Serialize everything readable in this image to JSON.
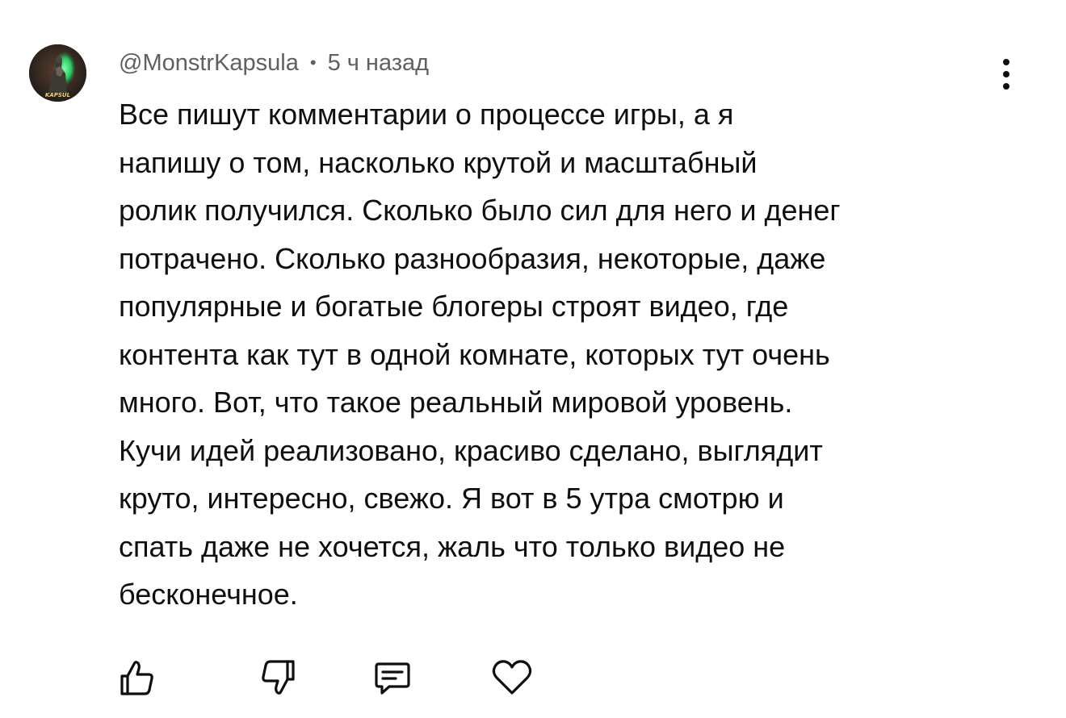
{
  "comment": {
    "author": "@MonstrKapsula",
    "separator": "•",
    "time_ago": "5 ч назад",
    "text": "Все пишут комментарии о процессе игры, а я\nнапишу о том, насколько крутой и масштабный\nролик получился. Сколько было сил для него и денег\nпотрачено. Сколько разнообразия, некоторые, даже\nпопулярные и богатые блогеры строят видео, где\nконтента как тут в одной комнате, которых тут очень\nмного. Вот, что такое реальный мировой уровень.\nКучи идей реализовано, красиво сделано, выглядит\nкруто, интересно, свежо. Я вот в 5 утра смотрю и\nспать даже не хочется, жаль что только видео не\nбесконечное.",
    "avatar_text": "KAPSUL"
  },
  "icons": {
    "menu": "more-vertical-icon",
    "like": "thumbs-up-icon",
    "dislike": "thumbs-down-icon",
    "reply": "comment-bubble-icon",
    "heart": "heart-icon"
  },
  "colors": {
    "text": "#0f0f0f",
    "meta": "#606060",
    "background": "#ffffff",
    "avatar_glow": "#3bd16f"
  }
}
